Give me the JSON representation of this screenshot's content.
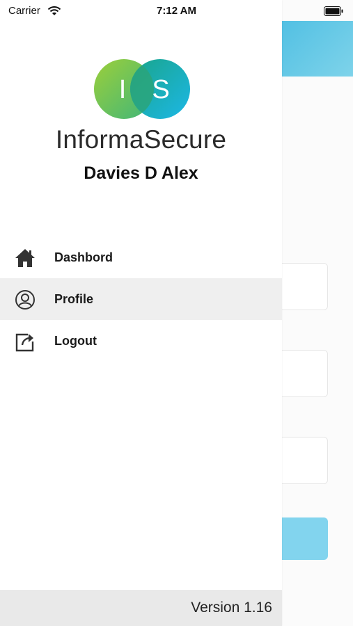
{
  "status_bar": {
    "carrier": "Carrier",
    "time": "7:12 AM"
  },
  "app": {
    "brand": "InformaSecure",
    "logo_letters": {
      "left": "I",
      "right": "S"
    },
    "logo_colors": {
      "left": "#8cc63f",
      "right": "#1fb6e0",
      "overlap": "#1aa58a"
    },
    "user_name": "Davies D Alex"
  },
  "menu": {
    "items": [
      {
        "label": "Dashbord",
        "icon": "home-icon",
        "active": false
      },
      {
        "label": "Profile",
        "icon": "user-circle-icon",
        "active": true
      },
      {
        "label": "Logout",
        "icon": "logout-icon",
        "active": false
      }
    ]
  },
  "footer": {
    "version": "Version 1.16"
  },
  "colors": {
    "accent": "#52c0e3",
    "active_row": "#efefef",
    "footer_bg": "#e9e9e9"
  }
}
